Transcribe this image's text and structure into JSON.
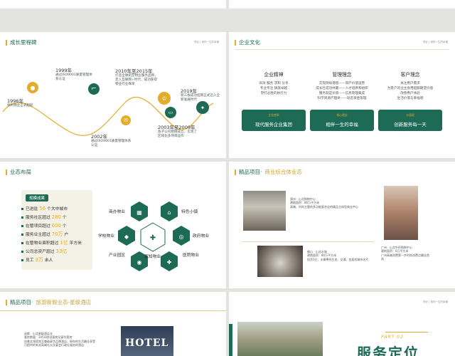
{
  "slide_tag": "物业 | 相伴一生的幸福",
  "s1": {
    "title": "成长里程碑",
    "milestones": [
      {
        "year": "1996年",
        "text": "保利物业正式起航"
      },
      {
        "year": "1999年",
        "text": "通过ISO9001质量管理体系认证"
      },
      {
        "year": "2002年",
        "text": "通过ISO9001质量管理体系认证"
      },
      {
        "year": "2010年至2015年",
        "text": "打造全球航空物业服务品牌，走入互联网+时代，成功获得物业行业殊荣"
      },
      {
        "year": "2003年至2009年",
        "text": "各子公司相继成立，实现了区域化多项目运作"
      },
      {
        "year": "2019年",
        "text": "新三板成功挂牌正式迈入全新发展时代"
      }
    ]
  },
  "s2": {
    "title": "企业文化",
    "columns": [
      {
        "head": "企业精神",
        "lines": [
          "高效 服务 求和 分享",
          "专业专注 铸就卓越",
          "塑打必胜的执行力"
        ],
        "sub": "企业使命",
        "box": "现代服务企业集团"
      },
      {
        "head": "管理理念",
        "lines": [
          "实现持续增值——资产价值运营",
          "成长壮成功共赢——人才培养和组织",
          "服务就是价值——信息管理集成",
          "科学资源产理体——动态资金管理"
        ],
        "sub": "核心理念",
        "box": "相伴一生的幸福"
      },
      {
        "head": "客户理念",
        "lines": [
          "关注用户需求",
          "为客户的业主会用超额期望价值",
          "改善用户体验",
          "生活价值与幸福感"
        ],
        "sub": "价值观",
        "box": "创新服务每一天"
      }
    ]
  },
  "s3": {
    "title": "业态布局",
    "badge": "规模成果",
    "stats": [
      {
        "pre": "已进驻",
        "num": "56",
        "post": "个大中城市"
      },
      {
        "pre": "服务社区超过",
        "num": "280",
        "post": "个"
      },
      {
        "pre": "在管项目超过",
        "num": "600",
        "post": "个"
      },
      {
        "pre": "服务业主超过",
        "num": "70万",
        "post": "户"
      },
      {
        "pre": "在管物业面积超过",
        "num": "1亿",
        "post": "平方米"
      },
      {
        "pre": "公司总资产超过",
        "num": "33亿",
        "post": ""
      },
      {
        "pre": "员工",
        "num": "3万",
        "post": "余人"
      }
    ],
    "labels": {
      "center": "现知物业",
      "top_left": "商办物业",
      "top_right": "特色小镇",
      "mid_left": "学校物业",
      "mid_right": "政府物业",
      "bot_left": "产业园区",
      "bot_right": "医院物业"
    }
  },
  "s4": {
    "title_a": "精品项目·",
    "title_b": "商业综合体业态",
    "p1": "郑州 · 山北购物中心\n建筑面积：86万平方米\n高端、时尚主题的多功能复合化的精品主体型商业中心",
    "p2": "佛山 · 山北水城\n建筑面积：80万平方米\n投资3亿、水寨粤的生态、交通、宜居的城市名片",
    "p3": "广州 · 山北中环购物中心\n建筑面积：6万平方米\n广州高端消费第一步时尚消费点最佳首选"
  },
  "s5": {
    "title_a": "精品项目·",
    "title_b": "旅游度假业态-星级酒店",
    "p": "成都 · 山北星级酒店业\n客房数量：345间舒适客房及豪华套房\n由着北领国宾至尊级豪华品牌酒店，致你的生活最佳享受\n可提供的有关高端礼仪及宴会行政礼服务的酒店",
    "hotel": "HOTEL"
  },
  "s6": {
    "part": "PART 02",
    "title": "服务定位"
  },
  "colors": {
    "primary": "#1d6a55",
    "accent": "#e3ac2a"
  }
}
